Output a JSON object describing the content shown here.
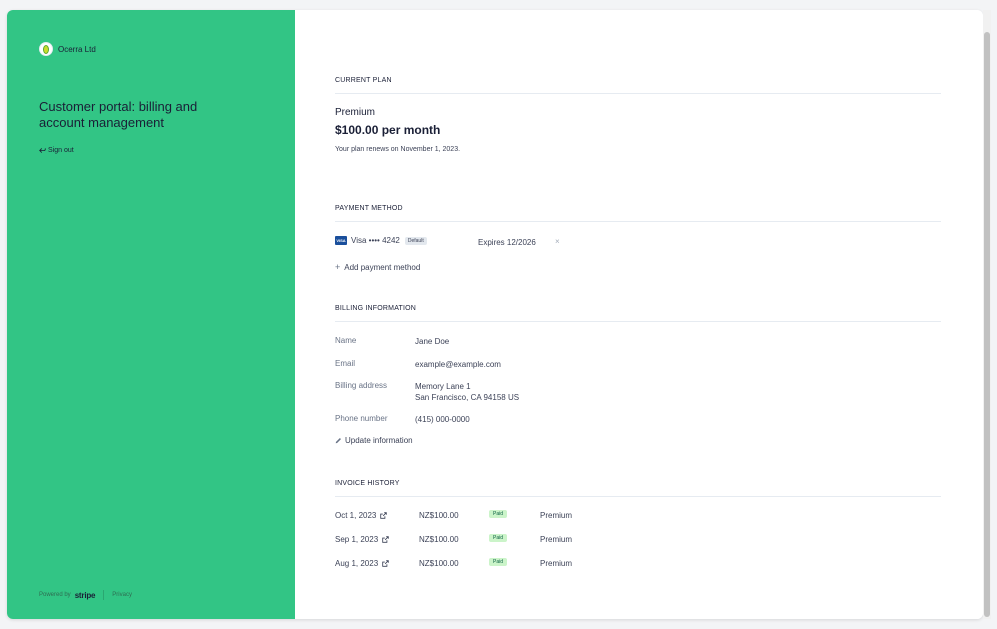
{
  "sidebar": {
    "company_name": "Ocerra Ltd",
    "portal_title": "Customer portal: billing and account management",
    "sign_out_label": "Sign out",
    "powered_by": "Powered by",
    "stripe_label": "stripe",
    "privacy_label": "Privacy",
    "accent_color": "#32c585"
  },
  "current_plan": {
    "heading": "CURRENT PLAN",
    "plan_name": "Premium",
    "price": "$100.00 per month",
    "renewal_text": "Your plan renews on November 1, 2023."
  },
  "payment_method": {
    "heading": "PAYMENT METHOD",
    "card_brand_icon": "VISA",
    "card_label": "Visa •••• 4242",
    "default_badge": "Default",
    "expires": "Expires 12/2026",
    "remove_glyph": "×",
    "add_label": "Add payment method"
  },
  "billing_information": {
    "heading": "BILLING INFORMATION",
    "rows": [
      {
        "label": "Name",
        "value": "Jane Doe"
      },
      {
        "label": "Email",
        "value": "example@example.com"
      },
      {
        "label": "Billing address",
        "value_line1": "Memory Lane 1",
        "value_line2": "San Francisco, CA 94158 US"
      },
      {
        "label": "Phone number",
        "value": "(415) 000-0000"
      }
    ],
    "update_label": "Update information"
  },
  "invoice_history": {
    "heading": "INVOICE HISTORY",
    "invoices": [
      {
        "date": "Oct 1, 2023",
        "amount": "NZ$100.00",
        "status": "Paid",
        "plan": "Premium"
      },
      {
        "date": "Sep 1, 2023",
        "amount": "NZ$100.00",
        "status": "Paid",
        "plan": "Premium"
      },
      {
        "date": "Aug 1, 2023",
        "amount": "NZ$100.00",
        "status": "Paid",
        "plan": "Premium"
      }
    ]
  }
}
